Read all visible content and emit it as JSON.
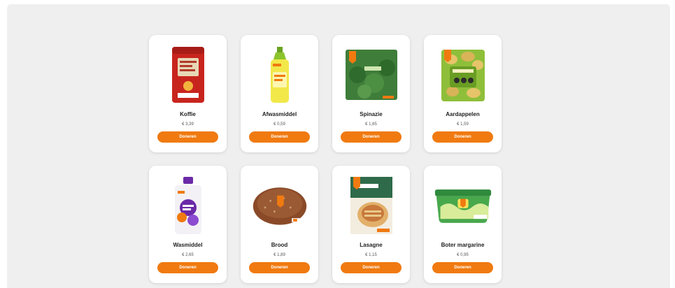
{
  "colors": {
    "accent": "#f07a10",
    "background": "#efefef",
    "card": "#ffffff"
  },
  "products": [
    {
      "name": "Koffie",
      "price": "€ 3,39",
      "button": "Doneren",
      "icon": "coffee-package-icon"
    },
    {
      "name": "Afwasmiddel",
      "price": "€ 0,59",
      "button": "Doneren",
      "icon": "dish-soap-bottle-icon"
    },
    {
      "name": "Spinazie",
      "price": "€ 1,65",
      "button": "Doneren",
      "icon": "spinach-bag-icon"
    },
    {
      "name": "Aardappelen",
      "price": "€ 1,59",
      "button": "Doneren",
      "icon": "potato-bag-icon"
    },
    {
      "name": "Wasmiddel",
      "price": "€ 2,65",
      "button": "Doneren",
      "icon": "detergent-bottle-icon"
    },
    {
      "name": "Brood",
      "price": "€ 1,89",
      "button": "Doneren",
      "icon": "bread-loaf-icon"
    },
    {
      "name": "Lasagne",
      "price": "€ 1,15",
      "button": "Doneren",
      "icon": "lasagne-box-icon"
    },
    {
      "name": "Boter margarine",
      "price": "€ 0,95",
      "button": "Doneren",
      "icon": "margarine-tub-icon"
    }
  ]
}
